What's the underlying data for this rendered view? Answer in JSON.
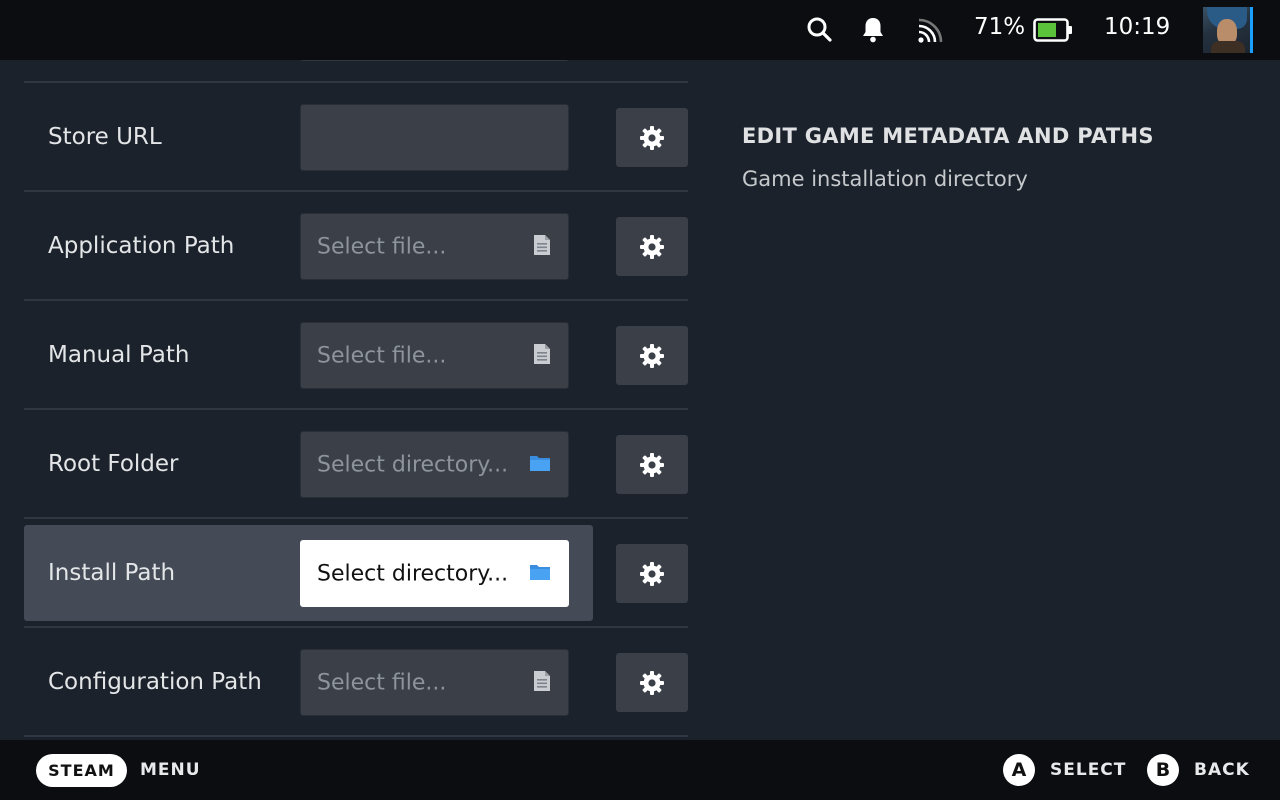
{
  "statusbar": {
    "battery_pct": "71%",
    "battery_level": 0.71,
    "time": "10:19"
  },
  "rows": [
    {
      "label": "Store URL",
      "placeholder": "",
      "icon": "none"
    },
    {
      "label": "Application Path",
      "placeholder": "Select file...",
      "icon": "file-icon"
    },
    {
      "label": "Manual Path",
      "placeholder": "Select file...",
      "icon": "file-icon"
    },
    {
      "label": "Root Folder",
      "placeholder": "Select directory...",
      "icon": "folder-icon"
    },
    {
      "label": "Install Path",
      "placeholder": "Select directory...",
      "icon": "folder-icon",
      "focused": true
    },
    {
      "label": "Configuration Path",
      "placeholder": "Select file...",
      "icon": "file-icon"
    }
  ],
  "help": {
    "title": "EDIT GAME METADATA AND PATHS",
    "description": "Game installation directory"
  },
  "footer": {
    "steam_label": "STEAM",
    "menu_label": "MENU",
    "a_glyph": "A",
    "select_label": "SELECT",
    "b_glyph": "B",
    "back_label": "BACK"
  },
  "colors": {
    "accent": "#1a9fff",
    "folder": "#3b8de0",
    "battery_fill": "#5ac33b"
  }
}
